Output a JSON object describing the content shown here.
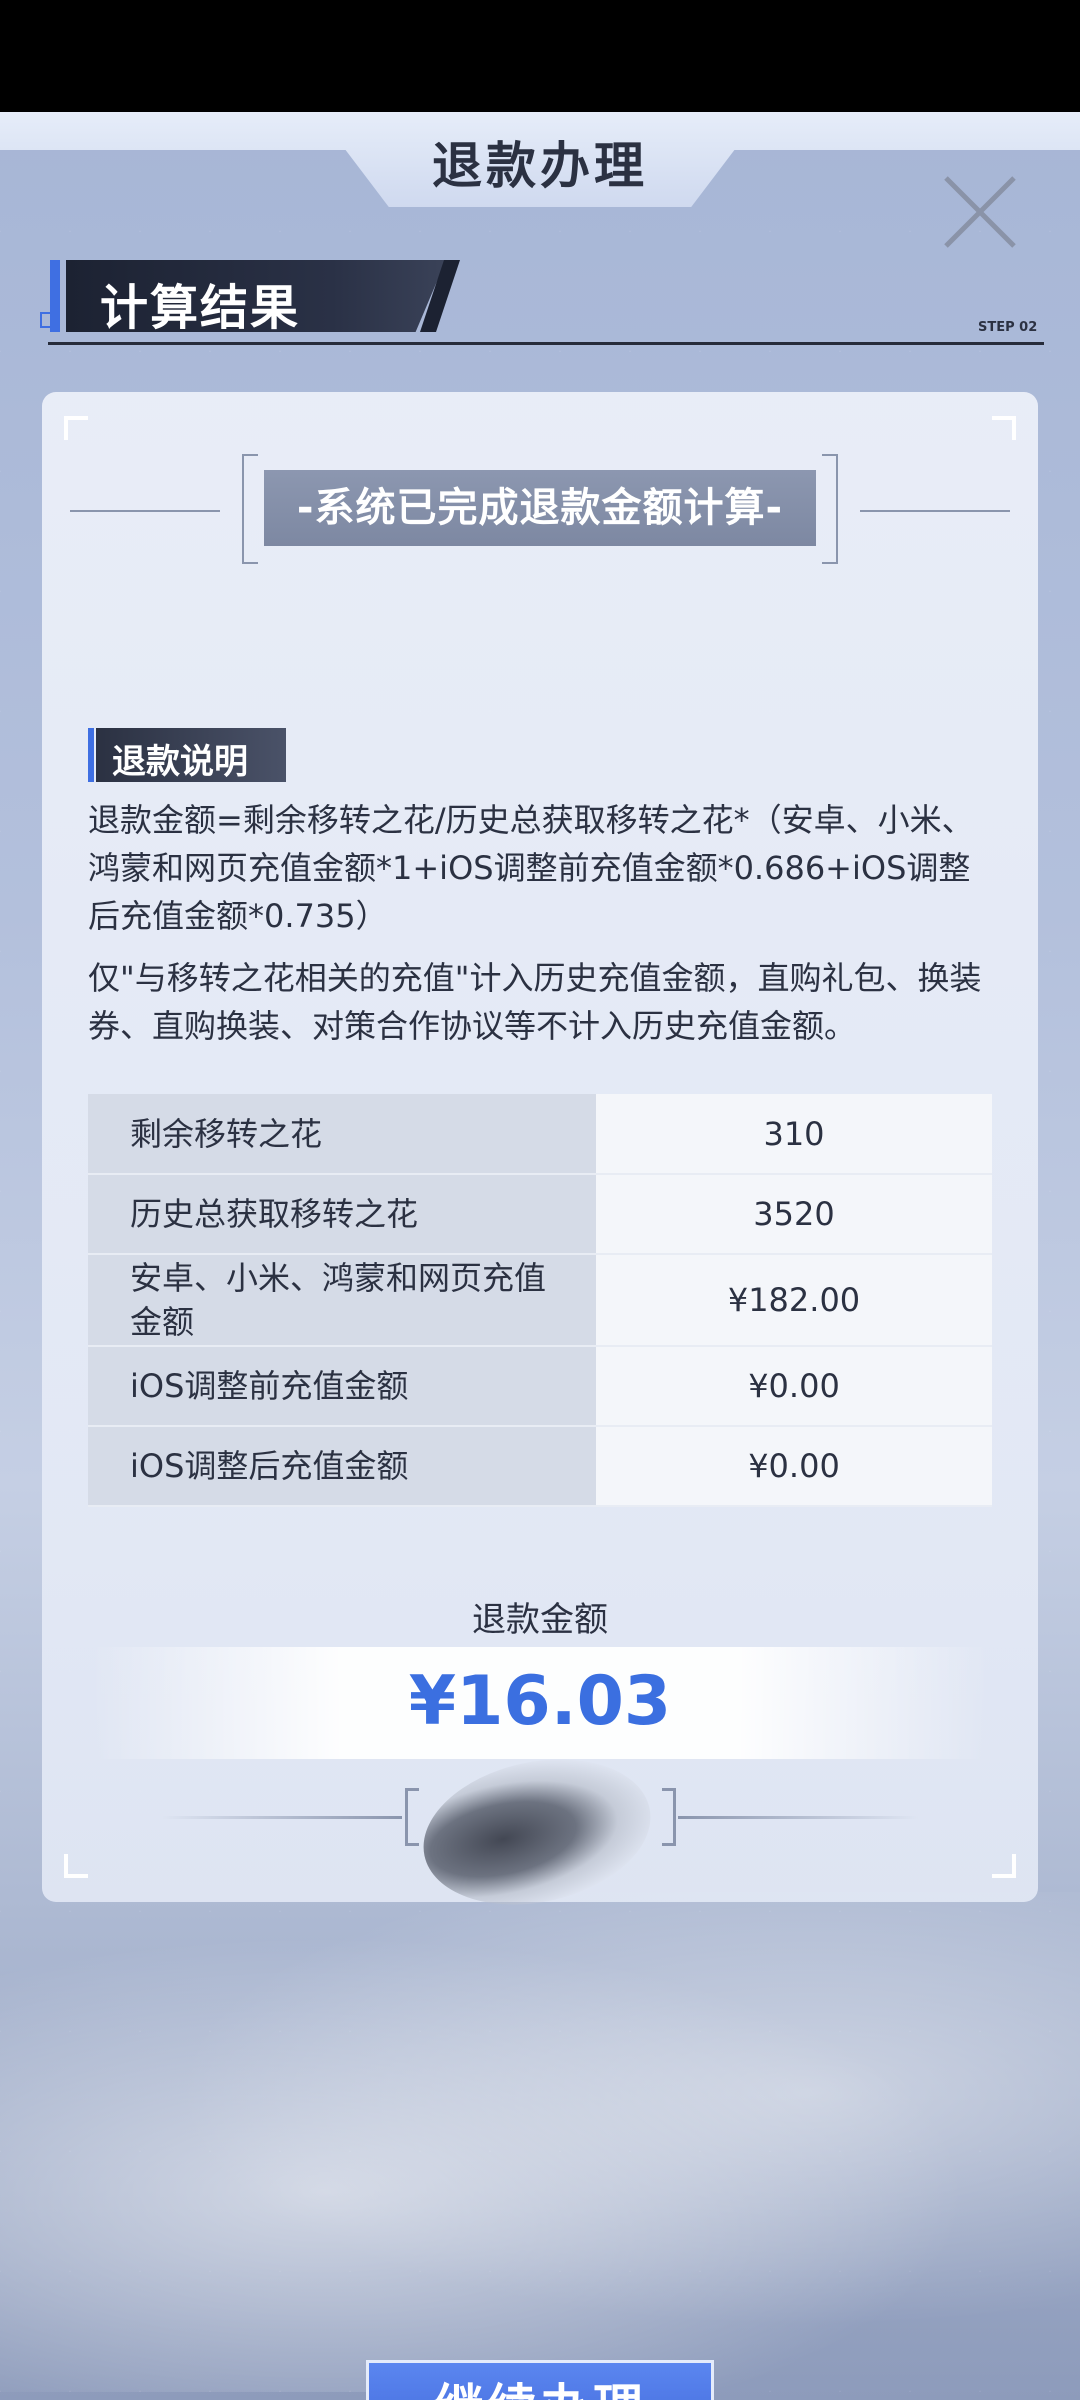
{
  "header": {
    "title": "退款办理",
    "close_icon": "close-icon"
  },
  "section": {
    "title": "计算结果",
    "step": "STEP 02"
  },
  "card": {
    "status": "-系统已完成退款金额计算-",
    "explanation_title": "退款说明",
    "explanation_1": "退款金额=剩余移转之花/历史总获取移转之花*（安卓、小米、鸿蒙和网页充值金额*1+iOS调整前充值金额*0.686+iOS调整后充值金额*0.735）",
    "explanation_2": "仅\"与移转之花相关的充值\"计入历史充值金额，直购礼包、换装券、直购换装、对策合作协议等不计入历史充值金额。",
    "table": [
      {
        "label": "剩余移转之花",
        "value": "310"
      },
      {
        "label": "历史总获取移转之花",
        "value": "3520"
      },
      {
        "label": "安卓、小米、鸿蒙和网页充值金额",
        "value": "¥182.00"
      },
      {
        "label": "iOS调整前充值金额",
        "value": "¥0.00"
      },
      {
        "label": "iOS调整后充值金额",
        "value": "¥0.00"
      }
    ],
    "refund_label": "退款金额",
    "refund_amount": "¥16.03"
  },
  "footer": {
    "continue_label": "继续办理"
  },
  "colors": {
    "accent": "#3f6fe2",
    "amount": "#3b6fe0",
    "dark": "#2b3142"
  }
}
